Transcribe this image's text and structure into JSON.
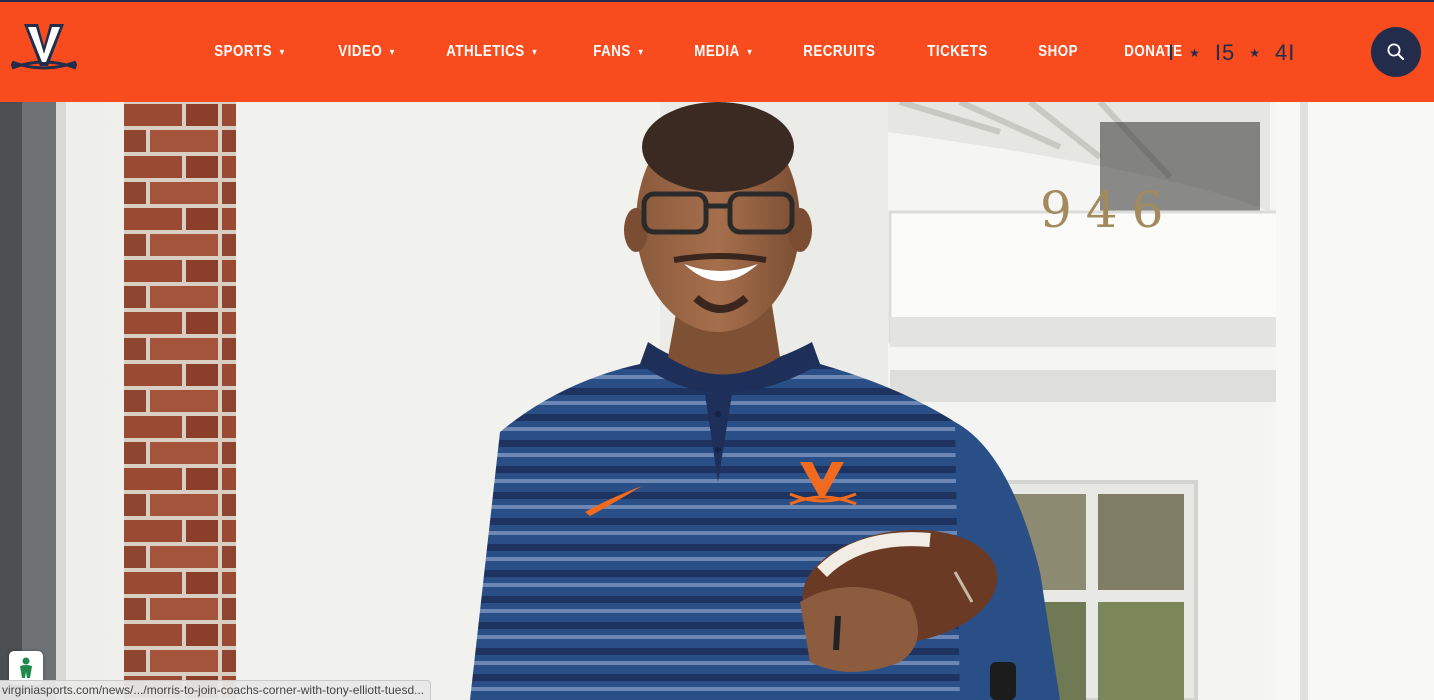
{
  "site": {
    "logo_icon": "uva-v-sabres-logo",
    "colors": {
      "orange": "#F84C1E",
      "navy": "#232D4B",
      "white": "#FFFFFF"
    }
  },
  "nav": {
    "items": [
      {
        "label": "SPORTS",
        "has_dropdown": true
      },
      {
        "label": "VIDEO",
        "has_dropdown": true
      },
      {
        "label": "ATHLETICS",
        "has_dropdown": true
      },
      {
        "label": "FANS",
        "has_dropdown": true
      },
      {
        "label": "MEDIA",
        "has_dropdown": true
      },
      {
        "label": "RECRUITS",
        "has_dropdown": false
      },
      {
        "label": "TICKETS",
        "has_dropdown": false
      },
      {
        "label": "SHOP",
        "has_dropdown": false
      },
      {
        "label": "DONATE",
        "has_dropdown": false
      }
    ],
    "caret": "▼"
  },
  "brand_mark": {
    "left": "I",
    "star": "★",
    "middle": "I5",
    "right": "4I"
  },
  "search": {
    "icon": "search-icon"
  },
  "hero": {
    "door_number": "946",
    "subject": "coach-photo"
  },
  "status_bar": {
    "url": "virginiasports.com/news/.../morris-to-join-coachs-corner-with-tony-elliott-tuesd..."
  },
  "accessibility": {
    "icon": "accessibility-icon"
  }
}
